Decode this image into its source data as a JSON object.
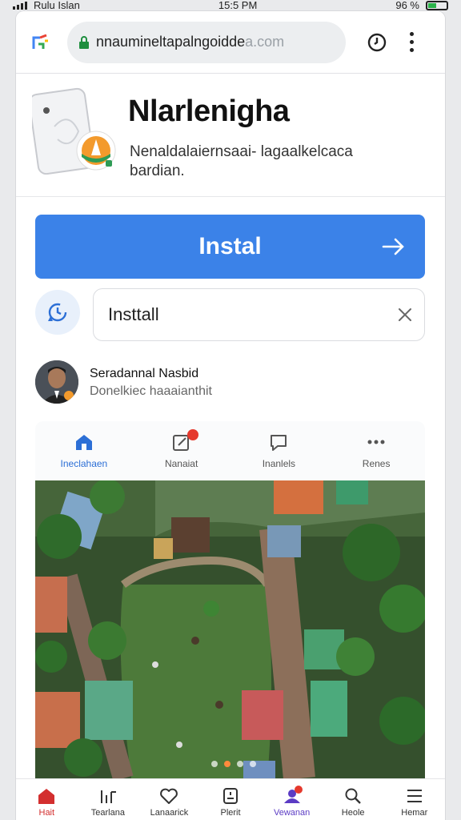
{
  "status": {
    "carrier": "Rulu Islan",
    "time": "15:5 PM",
    "battery": "96 %"
  },
  "browser": {
    "url_main": "nnaumineltapalngoidde",
    "url_fade": "a.com",
    "tab_icon": "google-tab-icon",
    "history_icon": "history-icon",
    "menu_icon": "more-vert-icon"
  },
  "app": {
    "name": "Nlarlenigha",
    "description": "Nenaldalaiernsaai- lagaalkelcaca bardian."
  },
  "install_button": {
    "label": "Instal"
  },
  "search": {
    "value": "Insttall"
  },
  "developer": {
    "name": "Seradannal Nasbid",
    "subtitle": "Donelkiec haaaianthit"
  },
  "tabs": [
    {
      "label": "Ineclahaen",
      "icon": "home-icon",
      "active": true
    },
    {
      "label": "Nanaiat",
      "icon": "edit-icon",
      "active": false
    },
    {
      "label": "Inanlels",
      "icon": "chat-icon",
      "active": false
    },
    {
      "label": "Renes",
      "icon": "more-horiz-icon",
      "active": false
    }
  ],
  "carousel": {
    "page": 2,
    "pages": 4
  },
  "bottom_nav": [
    {
      "label": "Hait",
      "icon": "home-icon"
    },
    {
      "label": "Tearlana",
      "icon": "chart-icon"
    },
    {
      "label": "Lanaarick",
      "icon": "heart-icon"
    },
    {
      "label": "Plerit",
      "icon": "receipt-icon"
    },
    {
      "label": "Vewanan",
      "icon": "group-icon"
    },
    {
      "label": "Heole",
      "icon": "search-icon"
    },
    {
      "label": "Hemar",
      "icon": "menu-icon"
    }
  ],
  "colors": {
    "accent_blue": "#3b82e8",
    "active_red": "#d32f2f",
    "badge_red": "#e5392d"
  }
}
